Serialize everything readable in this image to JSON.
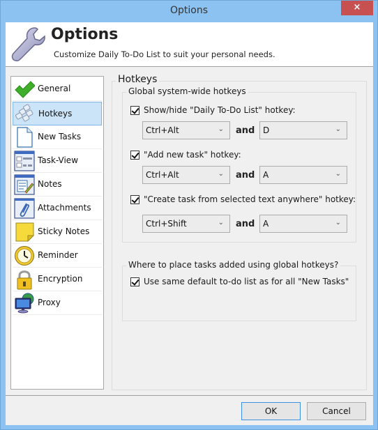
{
  "window": {
    "title": "Options",
    "close_label": "×"
  },
  "header": {
    "title": "Options",
    "subtitle": "Customize Daily To-Do List to suit your personal needs.",
    "icon": "wrench-icon"
  },
  "sidebar": {
    "selected": "Hotkeys",
    "items": [
      {
        "label": "General",
        "icon": "checkmark-icon"
      },
      {
        "label": "Hotkeys",
        "icon": "keyboard-keys-icon"
      },
      {
        "label": "New Tasks",
        "icon": "blank-page-icon"
      },
      {
        "label": "Task-View",
        "icon": "task-view-icon"
      },
      {
        "label": "Notes",
        "icon": "notes-pencil-icon"
      },
      {
        "label": "Attachments",
        "icon": "paperclip-icon"
      },
      {
        "label": "Sticky Notes",
        "icon": "sticky-note-icon"
      },
      {
        "label": "Reminder",
        "icon": "clock-icon"
      },
      {
        "label": "Encryption",
        "icon": "padlock-icon"
      },
      {
        "label": "Proxy",
        "icon": "network-monitor-icon"
      }
    ]
  },
  "main": {
    "section_title": "Hotkeys",
    "global_group": {
      "title": "Global system-wide hotkeys",
      "hotkeys": [
        {
          "label": "Show/hide \"Daily To-Do List\" hotkey:",
          "checked": true,
          "modifier": "Ctrl+Alt",
          "key": "D"
        },
        {
          "label": "\"Add new task\" hotkey:",
          "checked": true,
          "modifier": "Ctrl+Alt",
          "key": "A"
        },
        {
          "label": "\"Create task from selected text anywhere\" hotkey:",
          "checked": true,
          "modifier": "Ctrl+Shift",
          "key": "A"
        }
      ],
      "and_label": "and"
    },
    "placement_group": {
      "title": "Where to place tasks added using global hotkeys?",
      "option_label": "Use same default to-do list as for all \"New Tasks\"",
      "option_checked": true
    }
  },
  "footer": {
    "ok_label": "OK",
    "cancel_label": "Cancel"
  },
  "colors": {
    "frame": "#8cc2f2",
    "close": "#c75050",
    "selection": "#cce4f7",
    "default_button_border": "#3c8fdf"
  }
}
